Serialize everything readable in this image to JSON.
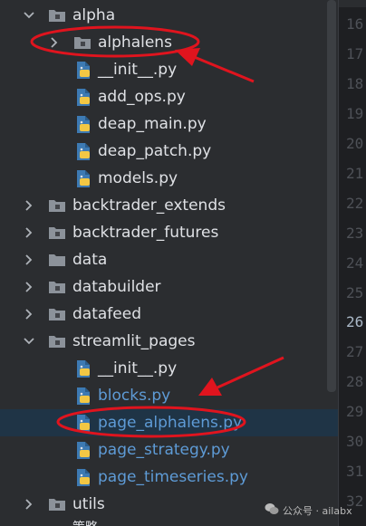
{
  "tree": {
    "items": [
      {
        "label": "alpha",
        "type": "folder",
        "expanded": true
      },
      {
        "label": "alphalens",
        "type": "folder",
        "expanded": false
      },
      {
        "label": "__init__.py",
        "type": "file"
      },
      {
        "label": "add_ops.py",
        "type": "file"
      },
      {
        "label": "deap_main.py",
        "type": "file"
      },
      {
        "label": "deap_patch.py",
        "type": "file"
      },
      {
        "label": "models.py",
        "type": "file"
      },
      {
        "label": "backtrader_extends",
        "type": "folder",
        "expanded": false
      },
      {
        "label": "backtrader_futures",
        "type": "folder",
        "expanded": false
      },
      {
        "label": "data",
        "type": "folder",
        "expanded": false
      },
      {
        "label": "databuilder",
        "type": "folder",
        "expanded": false
      },
      {
        "label": "datafeed",
        "type": "folder",
        "expanded": false
      },
      {
        "label": "streamlit_pages",
        "type": "folder",
        "expanded": true
      },
      {
        "label": "__init__.py",
        "type": "file"
      },
      {
        "label": "blocks.py",
        "type": "file",
        "color": "#5e9bd6"
      },
      {
        "label": "page_alphalens.py",
        "type": "file",
        "color": "#5e9bd6",
        "selected": true
      },
      {
        "label": "page_strategy.py",
        "type": "file",
        "color": "#5e9bd6"
      },
      {
        "label": "page_timeseries.py",
        "type": "file",
        "color": "#5e9bd6"
      },
      {
        "label": "utils",
        "type": "folder",
        "expanded": false
      }
    ],
    "bottom_partial": "策略"
  },
  "gutter": {
    "line_numbers": [
      "16",
      "17",
      "18",
      "19",
      "20",
      "21",
      "22",
      "23",
      "24",
      "25",
      "26",
      "27",
      "28",
      "29",
      "30",
      "31",
      "32"
    ],
    "active_line": "26"
  },
  "annotations": {
    "color": "#e0141e",
    "highlighted_items": [
      "alphalens",
      "page_alphalens.py"
    ]
  },
  "watermark": {
    "text": "公众号 · ailabx"
  },
  "colors": {
    "background": "#2b2d30",
    "text": "#dfe1e5",
    "modified_file": "#5e9bd6",
    "selection": "#1f3446",
    "folder": "#8c929a",
    "python_blue": "#3d7ab3",
    "python_yellow": "#f2c744"
  }
}
